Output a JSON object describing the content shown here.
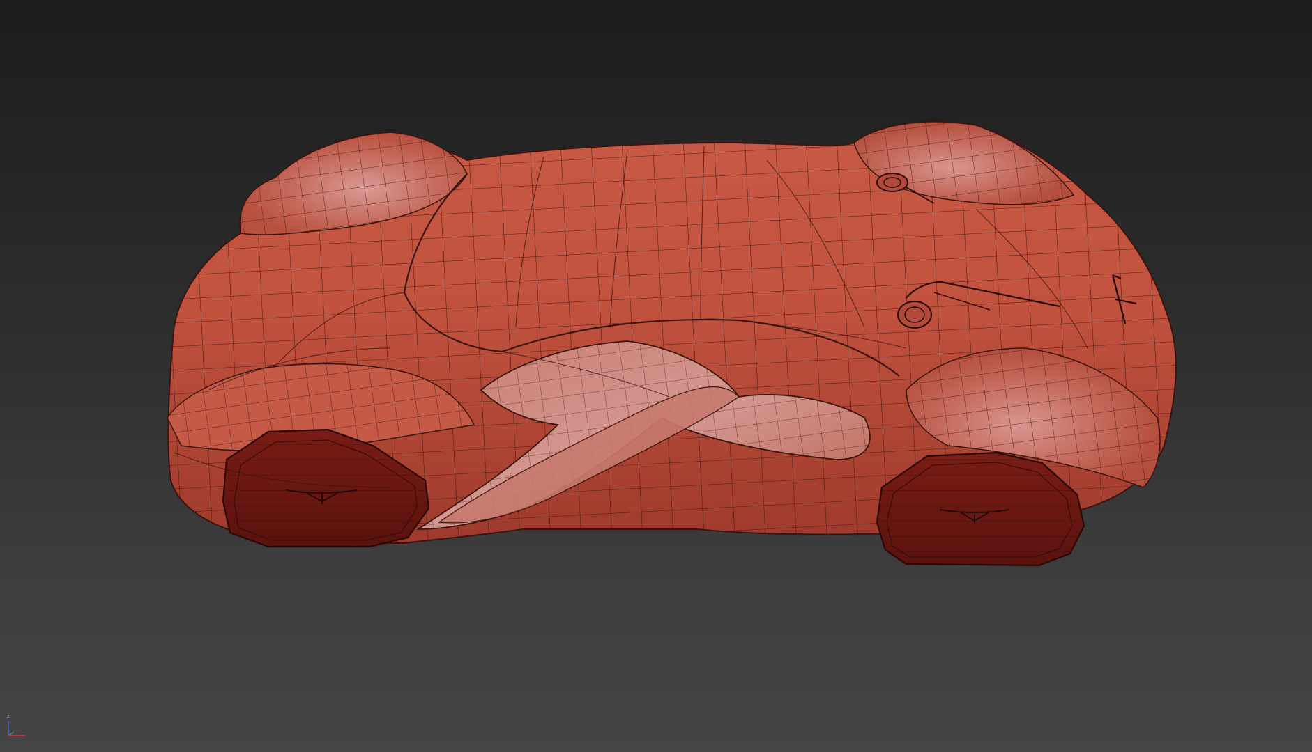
{
  "viewport": {
    "background_top": "#1d1d1d",
    "background_bottom": "#454545"
  },
  "model": {
    "name": "car-body-mesh",
    "surface_color": "#c2533f",
    "wire_color": "#3a1410",
    "wheel_color": "#6e1712"
  },
  "axis_gizmo": {
    "z_label": "z",
    "x_color": "#d04040",
    "z_color": "#5060d0",
    "y_color": "#40a040"
  }
}
